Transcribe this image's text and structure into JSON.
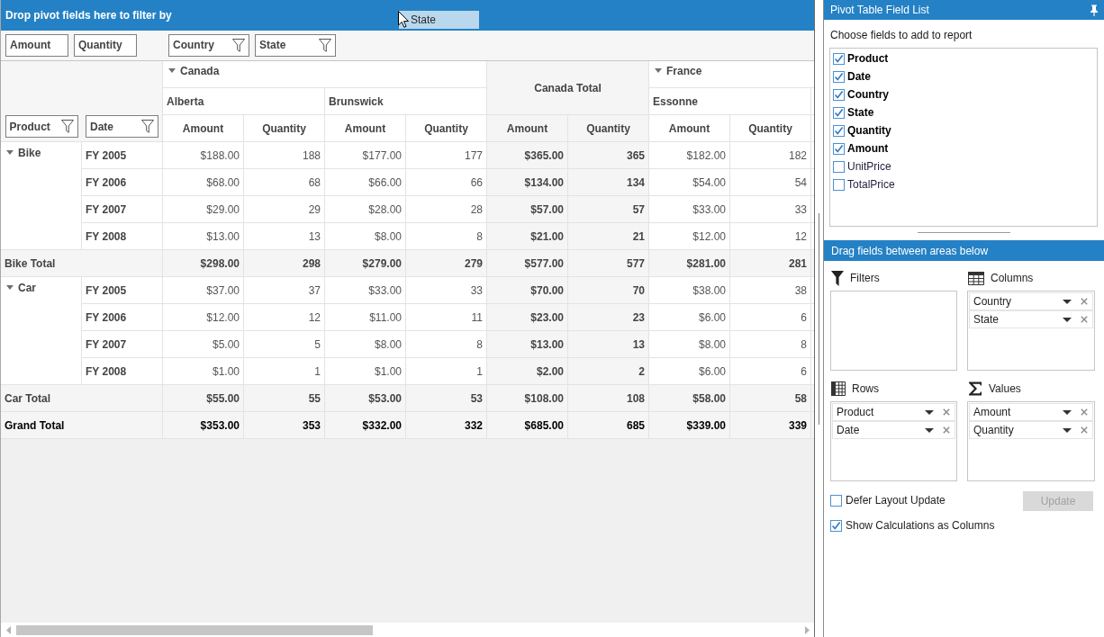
{
  "pivot_grid": {
    "filter_area": {
      "title": "Drop pivot fields here to filter by"
    },
    "drag_preview": {
      "label": "State"
    },
    "value_fields": [
      {
        "label": "Amount"
      },
      {
        "label": "Quantity"
      }
    ],
    "column_fields": [
      {
        "label": "Country"
      },
      {
        "label": "State"
      }
    ],
    "row_fields": [
      {
        "label": "Product"
      },
      {
        "label": "Date"
      }
    ],
    "column_groups": [
      {
        "kind": "group",
        "label": "Canada",
        "expanded": true,
        "children": [
          {
            "label": "Alberta",
            "measures": [
              "Amount",
              "Quantity"
            ]
          },
          {
            "label": "Brunswick",
            "measures": [
              "Amount",
              "Quantity"
            ]
          }
        ]
      },
      {
        "kind": "total",
        "label": "Canada Total",
        "measures": [
          "Amount",
          "Quantity"
        ]
      },
      {
        "kind": "group",
        "label": "France",
        "expanded": true,
        "children": [
          {
            "label": "Essonne",
            "measures": [
              "Amount",
              "Quantity"
            ]
          }
        ]
      }
    ],
    "row_groups": [
      {
        "kind": "group",
        "label": "Bike",
        "expanded": true,
        "children": [
          {
            "label": "FY 2005",
            "cells": [
              "$188.00",
              "188",
              "$177.00",
              "177",
              "$365.00",
              "365",
              "$182.00",
              "182"
            ]
          },
          {
            "label": "FY 2006",
            "cells": [
              "$68.00",
              "68",
              "$66.00",
              "66",
              "$134.00",
              "134",
              "$54.00",
              "54"
            ]
          },
          {
            "label": "FY 2007",
            "cells": [
              "$29.00",
              "29",
              "$28.00",
              "28",
              "$57.00",
              "57",
              "$33.00",
              "33"
            ]
          },
          {
            "label": "FY 2008",
            "cells": [
              "$13.00",
              "13",
              "$8.00",
              "8",
              "$21.00",
              "21",
              "$12.00",
              "12"
            ]
          }
        ]
      },
      {
        "kind": "total",
        "label": "Bike Total",
        "cells": [
          "$298.00",
          "298",
          "$279.00",
          "279",
          "$577.00",
          "577",
          "$281.00",
          "281"
        ]
      },
      {
        "kind": "group",
        "label": "Car",
        "expanded": true,
        "children": [
          {
            "label": "FY 2005",
            "cells": [
              "$37.00",
              "37",
              "$33.00",
              "33",
              "$70.00",
              "70",
              "$38.00",
              "38"
            ]
          },
          {
            "label": "FY 2006",
            "cells": [
              "$12.00",
              "12",
              "$11.00",
              "11",
              "$23.00",
              "23",
              "$6.00",
              "6"
            ]
          },
          {
            "label": "FY 2007",
            "cells": [
              "$5.00",
              "5",
              "$8.00",
              "8",
              "$13.00",
              "13",
              "$8.00",
              "8"
            ]
          },
          {
            "label": "FY 2008",
            "cells": [
              "$1.00",
              "1",
              "$1.00",
              "1",
              "$2.00",
              "2",
              "$6.00",
              "6"
            ]
          }
        ]
      },
      {
        "kind": "total",
        "label": "Car Total",
        "cells": [
          "$55.00",
          "55",
          "$53.00",
          "53",
          "$108.00",
          "108",
          "$58.00",
          "58"
        ]
      },
      {
        "kind": "grand_total",
        "label": "Grand Total",
        "cells": [
          "$353.00",
          "353",
          "$332.00",
          "332",
          "$685.00",
          "685",
          "$339.00",
          "339"
        ]
      }
    ]
  },
  "field_list": {
    "title": "Pivot Table Field List",
    "prompt": "Choose fields to add to report",
    "fields": [
      {
        "label": "Product",
        "checked": true
      },
      {
        "label": "Date",
        "checked": true
      },
      {
        "label": "Country",
        "checked": true
      },
      {
        "label": "State",
        "checked": true
      },
      {
        "label": "Quantity",
        "checked": true
      },
      {
        "label": "Amount",
        "checked": true
      },
      {
        "label": "UnitPrice",
        "checked": false
      },
      {
        "label": "TotalPrice",
        "checked": false
      }
    ],
    "areas_title": "Drag fields between areas below",
    "areas": [
      {
        "kind": "filters",
        "label": "Filters"
      },
      {
        "kind": "columns",
        "label": "Columns",
        "items": [
          {
            "label": "Country"
          },
          {
            "label": "State"
          }
        ]
      },
      {
        "kind": "rows",
        "label": "Rows",
        "items": [
          {
            "label": "Product"
          },
          {
            "label": "Date"
          }
        ]
      },
      {
        "kind": "values",
        "label": "Values",
        "items": [
          {
            "label": "Amount"
          },
          {
            "label": "Quantity"
          }
        ]
      }
    ],
    "options": [
      {
        "label": "Defer Layout Update",
        "checked": false
      },
      {
        "label": "Show Calculations as Columns",
        "checked": true
      }
    ],
    "update_button": {
      "label": "Update",
      "disabled": true
    }
  }
}
